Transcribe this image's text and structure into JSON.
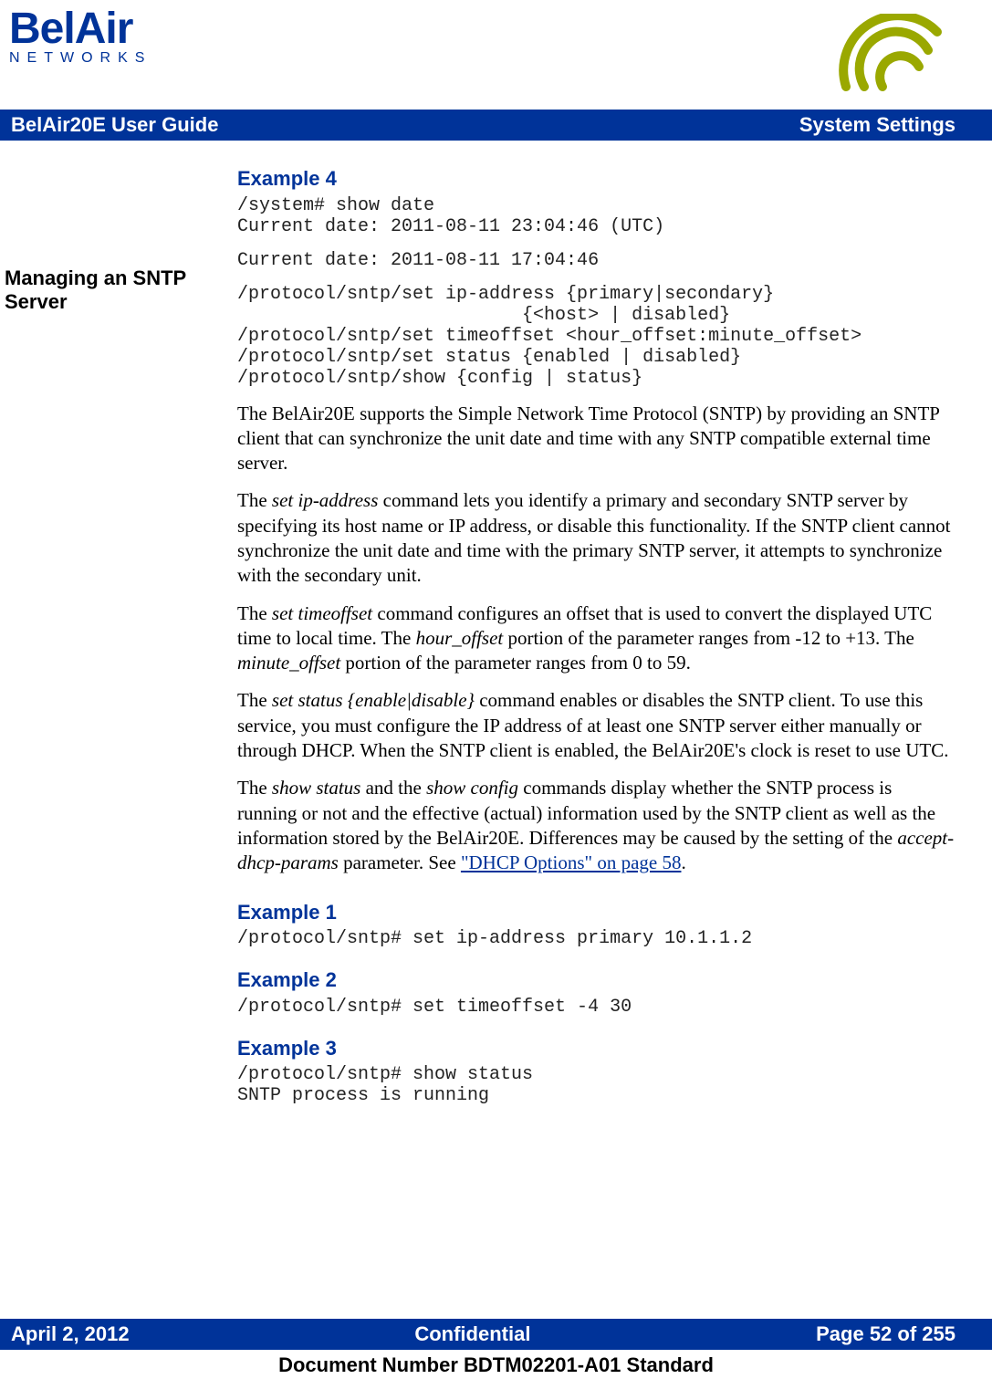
{
  "logo": {
    "top": "BelAir",
    "bottom": "NETWORKS"
  },
  "titleBar": {
    "left": "BelAir20E User Guide",
    "right": "System Settings"
  },
  "sideHeading": "Managing an SNTP Server",
  "ex4": {
    "heading": "Example 4",
    "code1": "/system# show date\nCurrent date: 2011-08-11 23:04:46 (UTC)",
    "code2": "Current date: 2011-08-11 17:04:46",
    "syntax": "/protocol/sntp/set ip-address {primary|secondary}\n                          {<host> | disabled}\n/protocol/sntp/set timeoffset <hour_offset:minute_offset>\n/protocol/sntp/set status {enabled | disabled}\n/protocol/sntp/show {config | status}"
  },
  "para1": "The BelAir20E supports the Simple Network Time Protocol (SNTP) by providing an SNTP client that can synchronize the unit date and time with any SNTP compatible external time server.",
  "para2": {
    "a": "The ",
    "b": "set ip-address",
    "c": " command lets you identify a primary and secondary SNTP server by specifying its host name or IP address, or disable this functionality. If the SNTP client cannot synchronize the unit date and time with the primary SNTP server, it attempts to synchronize with the secondary unit."
  },
  "para3": {
    "a": "The ",
    "b": "set timeoffset",
    "c": " command configures an offset that is used to convert the displayed UTC time to local time. The ",
    "d": "hour_offset",
    "e": " portion of the parameter ranges from -12 to +13. The ",
    "f": "minute_offset",
    "g": " portion of the parameter ranges from 0 to 59."
  },
  "para4": {
    "a": "The ",
    "b": "set status {enable|disable}",
    "c": " command enables or disables the SNTP client. To use this service, you must configure the IP address of at least one SNTP server either manually or through DHCP. When the SNTP client is enabled, the BelAir20E's clock is reset to use UTC."
  },
  "para5": {
    "a": "The ",
    "b": "show status",
    "c": " and the ",
    "d": "show config",
    "e": " commands display whether the SNTP process is running or not and the effective (actual) information used by the SNTP client as well as the information stored by the BelAir20E. Differences may be caused by the setting of the ",
    "f": "accept-dhcp-params",
    "g": " parameter. See ",
    "link": "\"DHCP Options\" on page 58",
    "h": "."
  },
  "ex1": {
    "heading": "Example 1",
    "code": "/protocol/sntp# set ip-address primary 10.1.1.2"
  },
  "ex2": {
    "heading": "Example 2",
    "code": "/protocol/sntp# set timeoffset -4 30"
  },
  "ex3": {
    "heading": "Example 3",
    "code": "/protocol/sntp# show status\nSNTP process is running"
  },
  "footer": {
    "left": "April 2, 2012",
    "center": "Confidential",
    "right": "Page 52 of 255"
  },
  "docNumber": "Document Number BDTM02201-A01 Standard"
}
